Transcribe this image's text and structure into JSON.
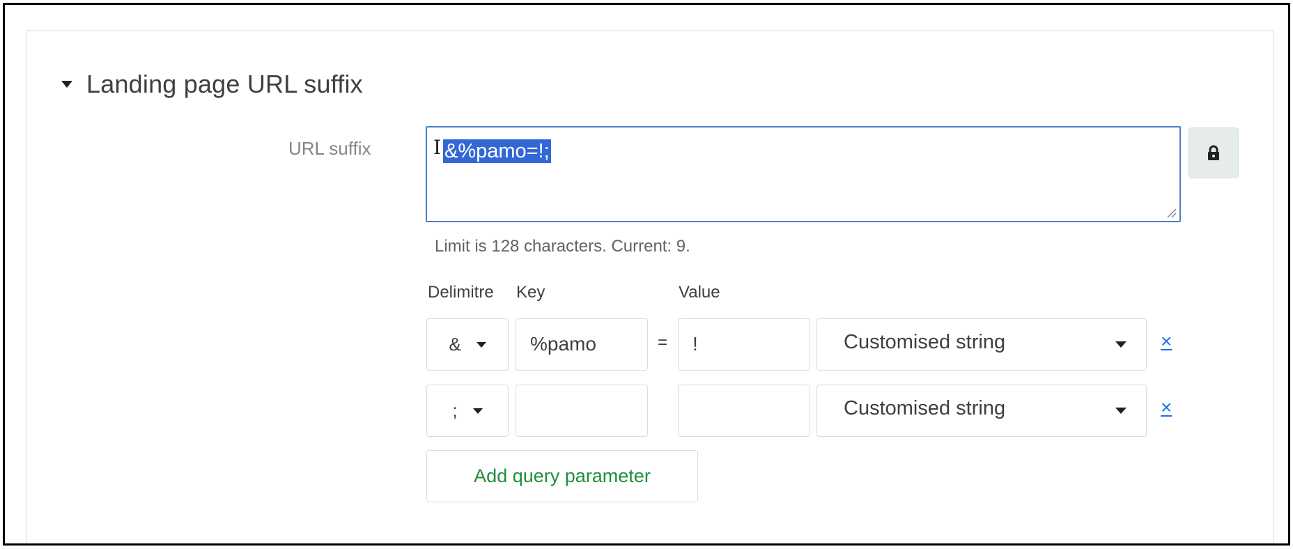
{
  "section": {
    "title": "Landing page URL suffix"
  },
  "url_suffix": {
    "label": "URL suffix",
    "value": "&%pamo=!;",
    "limit_text": "Limit is 128 characters. Current: 9."
  },
  "lock_button": {
    "icon": "lock-icon"
  },
  "columns": {
    "delimiter": "Delimitre",
    "key": "Key",
    "value": "Value"
  },
  "rows": [
    {
      "delimiter": "&",
      "key": "%pamo",
      "equals": "=",
      "value": "!",
      "type": "Customised string",
      "remove": "×"
    },
    {
      "delimiter": ";",
      "key": "",
      "equals": "",
      "value": "",
      "type": "Customised string",
      "remove": "×"
    }
  ],
  "add_button": {
    "label": "Add query parameter"
  },
  "colors": {
    "accent_blue": "#1a73e8",
    "selection": "#3367d6",
    "add_green": "#1e8e3e",
    "lock_bg": "#e6ede8"
  }
}
